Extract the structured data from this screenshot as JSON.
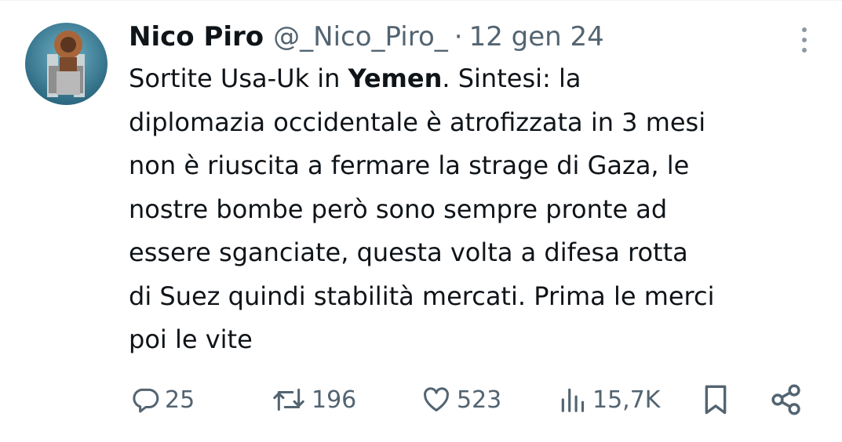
{
  "tweet": {
    "author_name": "Nico Piro",
    "author_handle": "@_Nico_Piro_",
    "separator": "·",
    "timestamp": "12 gen 24",
    "text_before_bold": "Sortite Usa-Uk in ",
    "text_bold": "Yemen",
    "text_after_bold": ". Sintesi: la\ndiplomazia occidentale è atrofizzata in 3 mesi\nnon è riuscita a fermare la strage di Gaza, le\nnostre bombe però sono sempre pronte ad\nessere sganciate, questa volta a difesa rotta\ndi Suez quindi stabilità mercati. Prima le merci\npoi le vite"
  },
  "actions": {
    "replies": "25",
    "retweets": "196",
    "likes": "523",
    "views": "15,7K"
  },
  "icons": {
    "reply": "reply-icon",
    "retweet": "retweet-icon",
    "like": "heart-icon",
    "views": "views-icon",
    "bookmark": "bookmark-icon",
    "share": "share-icon",
    "more": "more-icon"
  },
  "colors": {
    "text": "#0f1419",
    "secondary": "#536471"
  }
}
